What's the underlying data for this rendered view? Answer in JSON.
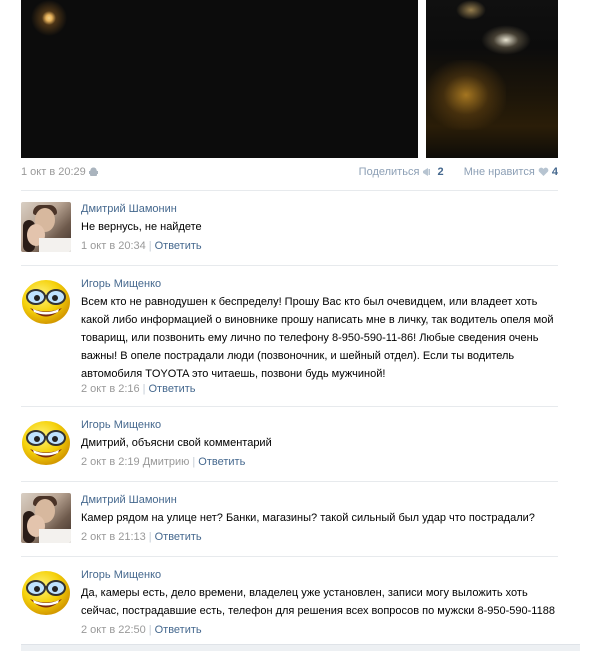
{
  "post": {
    "date": "1 окт в 20:29",
    "share_label": "Поделиться",
    "share_count": "2",
    "like_label": "Мне нравится",
    "like_count": "4"
  },
  "comments": [
    {
      "author": "Дмитрий Шамонин",
      "avatar": "couple-photo",
      "text": "Не вернусь, не найдете",
      "date": "1 окт в 20:34",
      "reply_to": "",
      "reply_label": "Ответить"
    },
    {
      "author": "Игорь Мищенко",
      "avatar": "smiley-glasses",
      "text": "Всем кто не равнодушен к беспределу! Прошу Вас кто был очевидцем, или владеет хоть какой либо информацией о виновнике прошу написать мне в личку, так водитель опеля мой товарищ, или позвонить ему лично по телефону 8-950-590-11-86! Любые сведения очень важны! В опеле пострадали люди (позвоночник, и шейный отдел). Если ты водитель автомобиля TOYOTA это читаешь, позвони будь мужчиной!",
      "date": "2 окт в 2:16",
      "reply_to": "",
      "reply_label": "Ответить"
    },
    {
      "author": "Игорь Мищенко",
      "avatar": "smiley-glasses",
      "text": "Дмитрий, объясни свой комментарий",
      "date": "2 окт в 2:19",
      "reply_to": "Дмитрию",
      "reply_label": "Ответить"
    },
    {
      "author": "Дмитрий Шамонин",
      "avatar": "couple-photo",
      "text": "Камер рядом на улице нет? Банки, магазины? такой сильный был удар что пострадали?",
      "date": "2 окт в 21:13",
      "reply_to": "",
      "reply_label": "Ответить"
    },
    {
      "author": "Игорь Мищенко",
      "avatar": "smiley-glasses",
      "text": "Да, камеры есть, дело времени, владелец уже установлен, записи могу выложить хоть сейчас, пострадавшие есть, телефон для решения всех вопросов по мужски 8-950-590-1188",
      "date": "2 окт в 22:50",
      "reply_to": "",
      "reply_label": "Ответить"
    }
  ]
}
